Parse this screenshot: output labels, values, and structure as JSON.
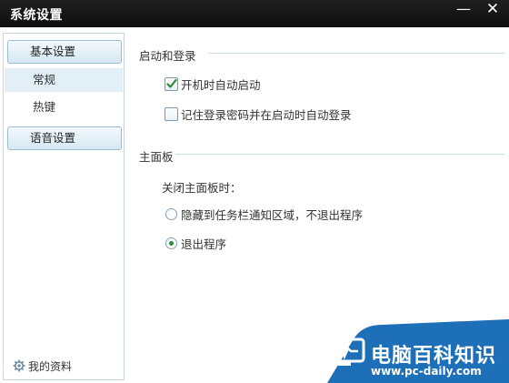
{
  "window": {
    "title": "系统设置",
    "minimize_glyph": "—",
    "close_glyph": "✕"
  },
  "sidebar": {
    "groups": [
      {
        "label": "基本设置",
        "items": [
          {
            "label": "常规",
            "selected": true
          },
          {
            "label": "热键",
            "selected": false
          }
        ]
      },
      {
        "label": "语音设置",
        "items": []
      }
    ],
    "footer": {
      "label": "我的资料",
      "icon": "gear-icon"
    }
  },
  "sections": {
    "startup": {
      "title": "启动和登录",
      "options": [
        {
          "label": "开机时自动启动",
          "checked": true
        },
        {
          "label": "记住登录密码并在启动时自动登录",
          "checked": false
        }
      ]
    },
    "main_panel": {
      "title": "主面板",
      "question": "关闭主面板时：",
      "options": [
        {
          "label": "隐藏到任务栏通知区域，不退出程序",
          "selected": false
        },
        {
          "label": "退出程序",
          "selected": true
        }
      ]
    }
  },
  "watermark": {
    "title": "电脑百科知识",
    "url": "www.pc-daily.com"
  },
  "colors": {
    "accent_check": "#2e8a3a",
    "titlebar": "#151515",
    "watermark_blue": "#1d6fb8"
  }
}
